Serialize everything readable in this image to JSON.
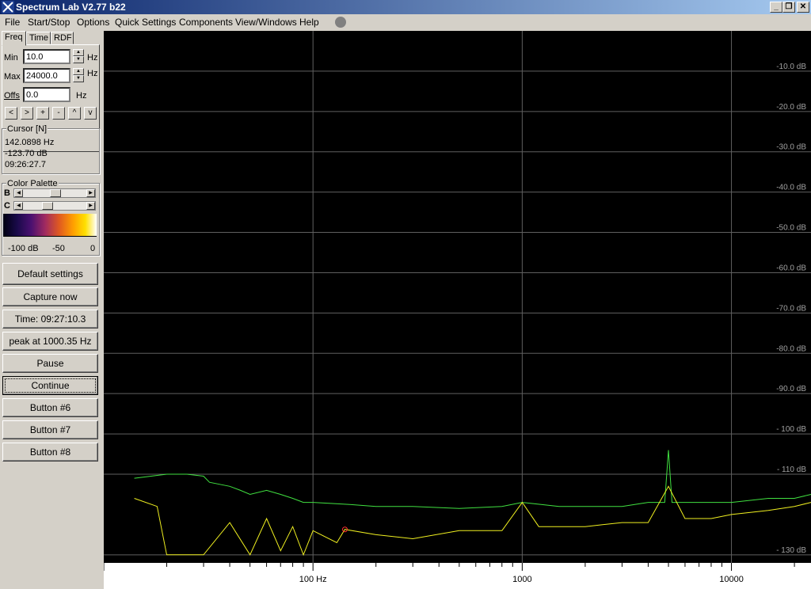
{
  "window": {
    "title": "Spectrum Lab V2.77 b22",
    "min_glyph": "_",
    "max_glyph": "❐",
    "close_glyph": "✕"
  },
  "menu": {
    "items": [
      "File",
      "Start/Stop",
      "Options",
      "Quick Settings",
      "Components",
      "View/Windows",
      "Help"
    ]
  },
  "tabs": [
    "Freq",
    "Time",
    "RDF"
  ],
  "freq": {
    "min_label": "Min",
    "min_value": "10.0",
    "min_unit": "Hz",
    "max_label": "Max",
    "max_value": "24000.0",
    "max_unit": "Hz",
    "offs_label": "Offs",
    "offs_value": "0.0",
    "offs_unit": "Hz",
    "nav_buttons": [
      "<",
      ">",
      "+",
      "-",
      "^",
      "v"
    ]
  },
  "cursor": {
    "title": "Cursor [N]",
    "freq": "142.0898 Hz",
    "level": "-123.70 dB",
    "time": "09:26:27.7"
  },
  "palette": {
    "title": "Color Palette",
    "b_label": "B",
    "c_label": "C",
    "b_level": 0.5,
    "c_level": 0.35,
    "scale": [
      "-100 dB",
      "-50",
      "0"
    ]
  },
  "buttons": [
    "Default settings",
    "Capture now",
    "Time:  09:27:10.3",
    "peak at 1000.35 Hz",
    "Pause",
    "Continue",
    "Button #6",
    "Button #7",
    "Button #8"
  ],
  "chart_data": {
    "type": "line",
    "background": "#000000",
    "x_scale": "log",
    "xlim": [
      10,
      24000
    ],
    "ylim": [
      -132,
      0
    ],
    "y_ticks": [
      -10,
      -20,
      -30,
      -40,
      -50,
      -60,
      -70,
      -80,
      -90,
      -100,
      -110,
      -130
    ],
    "y_tick_labels": [
      "-10.0 dB",
      "-20.0 dB",
      "-30.0 dB",
      "-40.0 dB",
      "-50.0 dB",
      "-60.0 dB",
      "-70.0 dB",
      "-80.0 dB",
      "-90.0 dB",
      "- 100 dB",
      "- 110 dB",
      "- 130 dB"
    ],
    "x_ticks_major": [
      100,
      1000,
      10000
    ],
    "x_tick_labels": [
      "100  Hz",
      "1000",
      "10000"
    ],
    "grid": true,
    "cursor_marker": {
      "freq": 142.09,
      "level": -123.7,
      "color": "#ff3030"
    },
    "series": [
      {
        "color": "#40e040",
        "points": [
          [
            14,
            -111
          ],
          [
            20,
            -110
          ],
          [
            25,
            -110
          ],
          [
            30,
            -110.5
          ],
          [
            32,
            -112
          ],
          [
            40,
            -113
          ],
          [
            45,
            -114
          ],
          [
            50,
            -115
          ],
          [
            60,
            -114
          ],
          [
            70,
            -115
          ],
          [
            80,
            -116
          ],
          [
            90,
            -117
          ],
          [
            100,
            -117
          ],
          [
            150,
            -117.5
          ],
          [
            200,
            -118
          ],
          [
            300,
            -118
          ],
          [
            500,
            -118.5
          ],
          [
            800,
            -118
          ],
          [
            1000,
            -117
          ],
          [
            1500,
            -118
          ],
          [
            2000,
            -118
          ],
          [
            3000,
            -118
          ],
          [
            4000,
            -117
          ],
          [
            4800,
            -117
          ],
          [
            5000,
            -104
          ],
          [
            5200,
            -117
          ],
          [
            6000,
            -117
          ],
          [
            8000,
            -117
          ],
          [
            10000,
            -117
          ],
          [
            15000,
            -116
          ],
          [
            20000,
            -116
          ],
          [
            24000,
            -115
          ]
        ]
      },
      {
        "color": "#f0f020",
        "points": [
          [
            14,
            -116
          ],
          [
            18,
            -118
          ],
          [
            20,
            -130
          ],
          [
            30,
            -130
          ],
          [
            40,
            -122
          ],
          [
            50,
            -130
          ],
          [
            60,
            -121
          ],
          [
            70,
            -129
          ],
          [
            80,
            -123
          ],
          [
            90,
            -130
          ],
          [
            100,
            -124
          ],
          [
            130,
            -127
          ],
          [
            142,
            -123.7
          ],
          [
            200,
            -125
          ],
          [
            300,
            -126
          ],
          [
            500,
            -124
          ],
          [
            800,
            -124
          ],
          [
            1000,
            -117
          ],
          [
            1200,
            -123
          ],
          [
            2000,
            -123
          ],
          [
            3000,
            -122
          ],
          [
            4000,
            -122
          ],
          [
            5000,
            -113
          ],
          [
            6000,
            -121
          ],
          [
            8000,
            -121
          ],
          [
            10000,
            -120
          ],
          [
            15000,
            -119
          ],
          [
            20000,
            -118
          ],
          [
            24000,
            -117
          ]
        ]
      }
    ]
  }
}
